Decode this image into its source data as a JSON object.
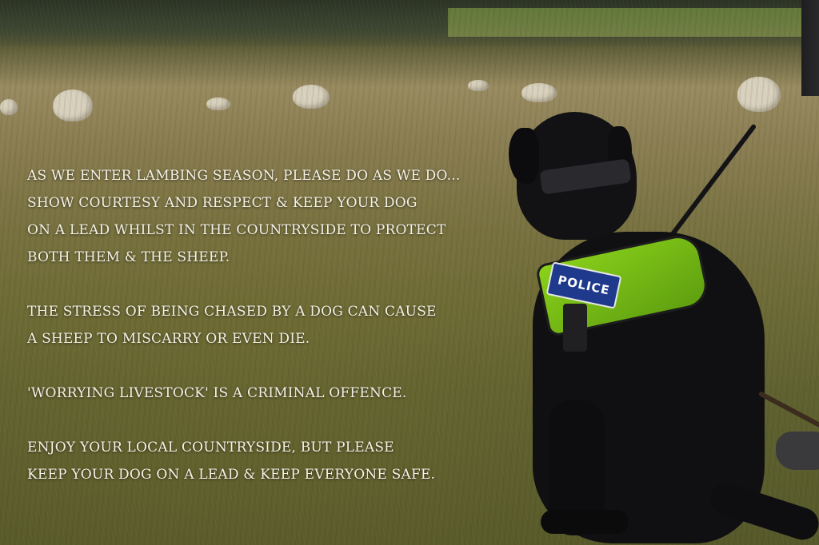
{
  "image": {
    "caption_paragraphs": [
      {
        "lines": [
          "AS WE ENTER LAMBING SEASON, PLEASE DO AS WE DO...",
          "SHOW COURTESY AND RESPECT & KEEP YOUR DOG",
          "ON A LEAD WHILST IN THE COUNTRYSIDE TO PROTECT",
          "BOTH THEM & THE SHEEP."
        ]
      },
      {
        "lines": [
          "THE STRESS OF BEING CHASED BY A DOG CAN CAUSE",
          "A SHEEP TO MISCARRY OR EVEN DIE."
        ]
      },
      {
        "lines": [
          "'WORRYING LIVESTOCK' IS A CRIMINAL OFFENCE."
        ]
      },
      {
        "lines": [
          "ENJOY YOUR LOCAL COUNTRYSIDE, BUT  PLEASE",
          "KEEP YOUR DOG ON A LEAD & KEEP EVERYONE SAFE."
        ]
      }
    ],
    "harness_badge": "POLICE"
  }
}
